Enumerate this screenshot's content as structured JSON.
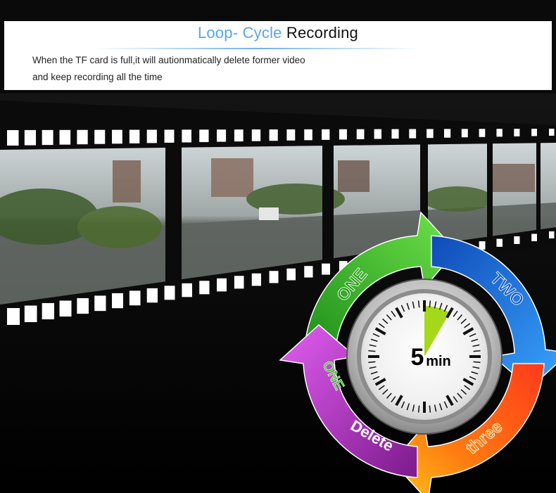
{
  "header": {
    "title_highlight": "Loop- Cycle",
    "title_rest": "Recording",
    "desc_line1": "When the TF card is full,it will autionmatically delete former video",
    "desc_line2": "and keep recording all the time"
  },
  "cycle": {
    "step1": "ONE",
    "step2": "TWO",
    "step3": "three",
    "delete_num": "ONE",
    "delete_word": "Delete",
    "timer_num": "5",
    "timer_unit": "min"
  },
  "colors": {
    "accent": "#59a6e6",
    "green": "#3fbf2a",
    "blue": "#1e6fd8",
    "red": "#e8301c",
    "purple": "#b12fc4"
  },
  "icons": [
    "film-strip",
    "stopwatch-icon",
    "cycle-arrows"
  ]
}
